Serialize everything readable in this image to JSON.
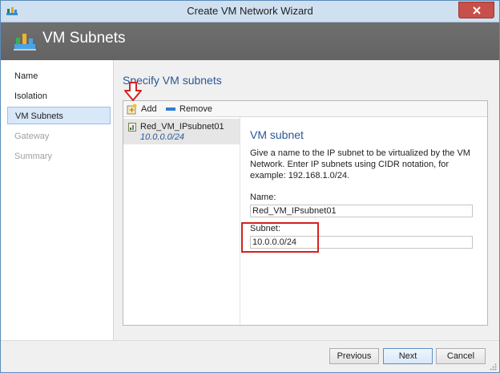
{
  "window": {
    "title": "Create VM Network Wizard"
  },
  "header": {
    "title": "VM Subnets"
  },
  "nav": {
    "items": [
      {
        "label": "Name",
        "state": "normal"
      },
      {
        "label": "Isolation",
        "state": "normal"
      },
      {
        "label": "VM Subnets",
        "state": "selected"
      },
      {
        "label": "Gateway",
        "state": "disabled"
      },
      {
        "label": "Summary",
        "state": "disabled"
      }
    ]
  },
  "main": {
    "section_title": "Specify VM subnets",
    "toolbar": {
      "add_label": "Add",
      "remove_label": "Remove"
    },
    "subnet_list": [
      {
        "name": "Red_VM_IPsubnet01",
        "subnet": "10.0.0.0/24"
      }
    ],
    "details": {
      "title": "VM subnet",
      "description": "Give a name to the IP subnet to be virtualized by the VM Network. Enter IP subnets using CIDR notation, for example: 192.168.1.0/24.",
      "name_label": "Name:",
      "name_value": "Red_VM_IPsubnet01",
      "subnet_label": "Subnet:",
      "subnet_value": "10.0.0.0/24"
    }
  },
  "footer": {
    "previous_label": "Previous",
    "next_label": "Next",
    "cancel_label": "Cancel"
  },
  "colors": {
    "accent": "#2b5797",
    "header_bg": "#6a6a6a",
    "selection_bg": "#d9e8f8",
    "highlight": "#d42121",
    "close_button": "#c7504a"
  },
  "icons": {
    "titlebar": "network-icon",
    "header": "network-icon",
    "add": "add-icon",
    "remove": "remove-icon",
    "subnet": "subnet-icon",
    "close": "close-icon",
    "annotation": "red-arrow-down-icon"
  }
}
